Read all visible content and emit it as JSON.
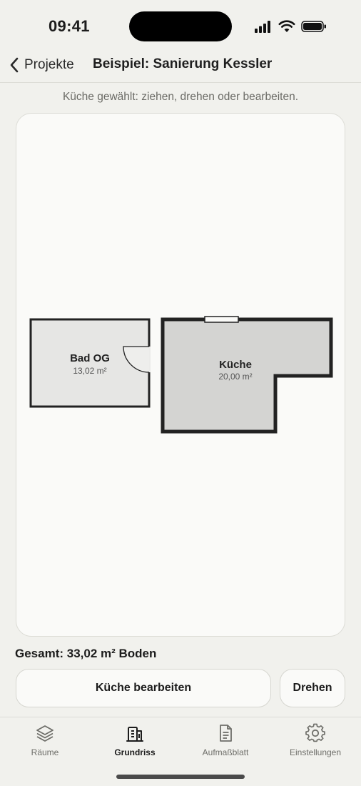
{
  "status": {
    "time": "09:41"
  },
  "nav": {
    "back_label": "Projekte",
    "title": "Beispiel: Sanierung Kessler"
  },
  "hint": "Küche gewählt: ziehen, drehen oder bearbeiten.",
  "rooms": [
    {
      "name": "Bad OG",
      "area": "13,02 m²",
      "selected": false
    },
    {
      "name": "Küche",
      "area": "20,00 m²",
      "selected": true
    }
  ],
  "total": "Gesamt: 33,02 m² Boden",
  "actions": {
    "edit_label": "Küche bearbeiten",
    "rotate_label": "Drehen"
  },
  "tabs": [
    {
      "label": "Räume",
      "icon": "layers-icon",
      "active": false
    },
    {
      "label": "Grundriss",
      "icon": "building-icon",
      "active": true
    },
    {
      "label": "Aufmaßblatt",
      "icon": "document-icon",
      "active": false
    },
    {
      "label": "Einstellungen",
      "icon": "gear-icon",
      "active": false
    }
  ],
  "colors": {
    "background": "#f1f1ed",
    "canvas": "#fafaf8",
    "selected_room_fill": "#d4d4d2",
    "room_fill": "#e6e6e4",
    "wall": "#222222"
  }
}
